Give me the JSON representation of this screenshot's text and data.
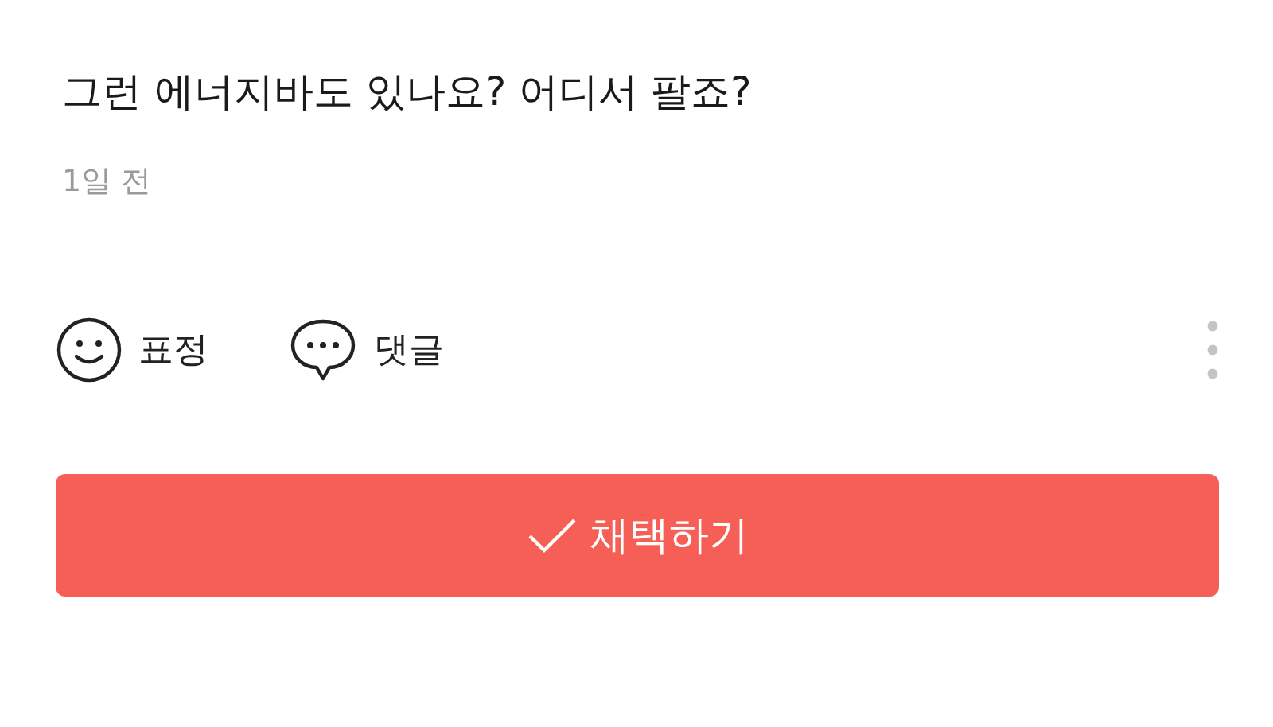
{
  "question": "그런 에너지바도 있나요? 어디서 팔죠?",
  "time": "1일 전",
  "actions": [
    {
      "kind": "reaction",
      "label": "표정"
    },
    {
      "kind": "comment",
      "label": "댓글"
    }
  ],
  "adopt_button": {
    "label": "채택하기"
  }
}
